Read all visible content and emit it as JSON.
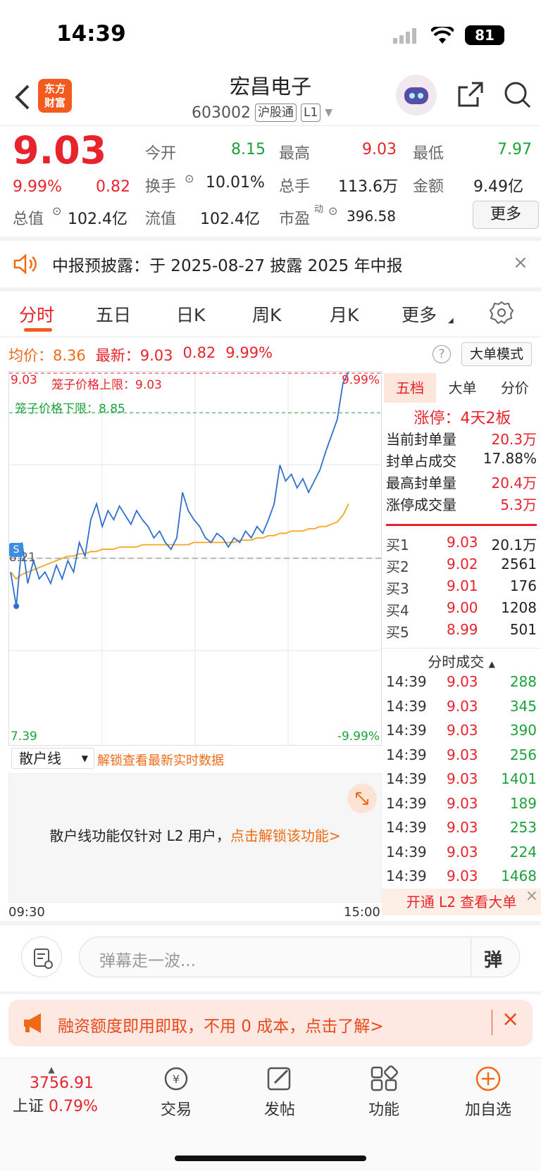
{
  "status_bar": {
    "time": "14:39",
    "battery": "81"
  },
  "header": {
    "stock_name": "宏昌电子",
    "stock_code": "603002",
    "tag_connect": "沪股通",
    "tag_level": "L1",
    "logo_line1": "东方",
    "logo_line2": "财富"
  },
  "quote": {
    "price": "9.03",
    "change_pct": "9.99%",
    "change": "0.82",
    "open_label": "今开",
    "open": "8.15",
    "high_label": "最高",
    "high": "9.03",
    "low_label": "最低",
    "low": "7.97",
    "turnover_label": "换手",
    "turnover": "10.01%",
    "volume_label": "总手",
    "volume": "113.6万",
    "amount_label": "金额",
    "amount": "9.49亿",
    "mktcap_label": "总值",
    "mktcap": "102.4亿",
    "float_label": "流值",
    "float": "102.4亿",
    "pe_label": "市盈",
    "pe_sup": "动",
    "pe": "396.58",
    "more": "更多"
  },
  "notice": {
    "text": "中报预披露：于 2025-08-27 披露 2025 年中报"
  },
  "tabs": [
    "分时",
    "五日",
    "日K",
    "周K",
    "月K",
    "更多"
  ],
  "chart_info": {
    "avg_label": "均价：",
    "avg": "8.36",
    "latest_label": "最新：",
    "latest": "9.03",
    "latest_change": "0.82",
    "latest_pct": "9.99%",
    "big_mode": "大单模式"
  },
  "chart_data": {
    "type": "line",
    "top_left": "9.03",
    "upper_limit_label": "笼子价格上限：9.03",
    "lower_limit_label": "笼子价格下限：8.85",
    "top_right": "9.99%",
    "base_label": "8.21",
    "bottom_left": "7.39",
    "bottom_right": "-9.99%",
    "x_start": "09:30",
    "x_end": "15:00",
    "ylim": [
      7.39,
      9.03
    ],
    "price": [
      8.15,
      8.0,
      8.28,
      8.1,
      8.2,
      8.12,
      8.15,
      8.1,
      8.18,
      8.12,
      8.2,
      8.15,
      8.28,
      8.22,
      8.38,
      8.45,
      8.35,
      8.42,
      8.38,
      8.44,
      8.4,
      8.36,
      8.42,
      8.38,
      8.35,
      8.3,
      8.33,
      8.28,
      8.25,
      8.3,
      8.5,
      8.42,
      8.38,
      8.35,
      8.3,
      8.28,
      8.32,
      8.3,
      8.26,
      8.3,
      8.28,
      8.33,
      8.3,
      8.35,
      8.32,
      8.38,
      8.45,
      8.62,
      8.55,
      8.58,
      8.52,
      8.56,
      8.5,
      8.55,
      8.6,
      8.68,
      8.75,
      8.82,
      8.98,
      9.03
    ],
    "average": [
      8.15,
      8.12,
      8.14,
      8.15,
      8.16,
      8.17,
      8.18,
      8.19,
      8.2,
      8.21,
      8.22,
      8.22,
      8.23,
      8.23,
      8.24,
      8.24,
      8.25,
      8.25,
      8.25,
      8.26,
      8.26,
      8.26,
      8.26,
      8.27,
      8.27,
      8.27,
      8.27,
      8.27,
      8.27,
      8.27,
      8.27,
      8.27,
      8.28,
      8.28,
      8.28,
      8.28,
      8.28,
      8.28,
      8.28,
      8.28,
      8.29,
      8.29,
      8.29,
      8.3,
      8.3,
      8.31,
      8.31,
      8.32,
      8.32,
      8.33,
      8.33,
      8.33,
      8.34,
      8.34,
      8.35,
      8.35,
      8.36,
      8.37,
      8.4,
      8.45
    ]
  },
  "right_panel": {
    "tabs": [
      "五档",
      "大单",
      "分价"
    ],
    "limit_status": "涨停：4天2板",
    "seal": [
      {
        "label": "当前封单量",
        "value": "20.3万"
      },
      {
        "label": "封单占成交",
        "value": "17.88%"
      },
      {
        "label": "最高封单量",
        "value": "20.4万"
      },
      {
        "label": "涨停成交量",
        "value": "5.3万"
      }
    ],
    "bids": [
      {
        "label": "买1",
        "price": "9.03",
        "vol": "20.1万"
      },
      {
        "label": "买2",
        "price": "9.02",
        "vol": "2561"
      },
      {
        "label": "买3",
        "price": "9.01",
        "vol": "176"
      },
      {
        "label": "买4",
        "price": "9.00",
        "vol": "1208"
      },
      {
        "label": "买5",
        "price": "8.99",
        "vol": "501"
      }
    ],
    "trades_title": "分时成交",
    "trades": [
      {
        "t": "14:39",
        "p": "9.03",
        "v": "288"
      },
      {
        "t": "14:39",
        "p": "9.03",
        "v": "345"
      },
      {
        "t": "14:39",
        "p": "9.03",
        "v": "390"
      },
      {
        "t": "14:39",
        "p": "9.03",
        "v": "256"
      },
      {
        "t": "14:39",
        "p": "9.03",
        "v": "1401"
      },
      {
        "t": "14:39",
        "p": "9.03",
        "v": "189"
      },
      {
        "t": "14:39",
        "p": "9.03",
        "v": "253"
      },
      {
        "t": "14:39",
        "p": "9.03",
        "v": "224"
      },
      {
        "t": "14:39",
        "p": "9.03",
        "v": "1468"
      }
    ],
    "l2_banner": "开通 L2 查看大单"
  },
  "sub_panel": {
    "select": "散户线",
    "unlock_hint": "解锁查看最新实时数据",
    "msg": "散户线功能仅针对 L2 用户，",
    "msg_link": "点击解锁该功能>"
  },
  "danmu": {
    "placeholder": "弹幕走一波...",
    "send": "弹"
  },
  "ad": {
    "text": "融资额度即用即取，不用 0 成本，点击了解>"
  },
  "bottom_nav": {
    "index_value": "3756.91",
    "index_name": "上证",
    "index_pct": "0.79%",
    "items": [
      "交易",
      "发帖",
      "功能",
      "加自选"
    ]
  }
}
